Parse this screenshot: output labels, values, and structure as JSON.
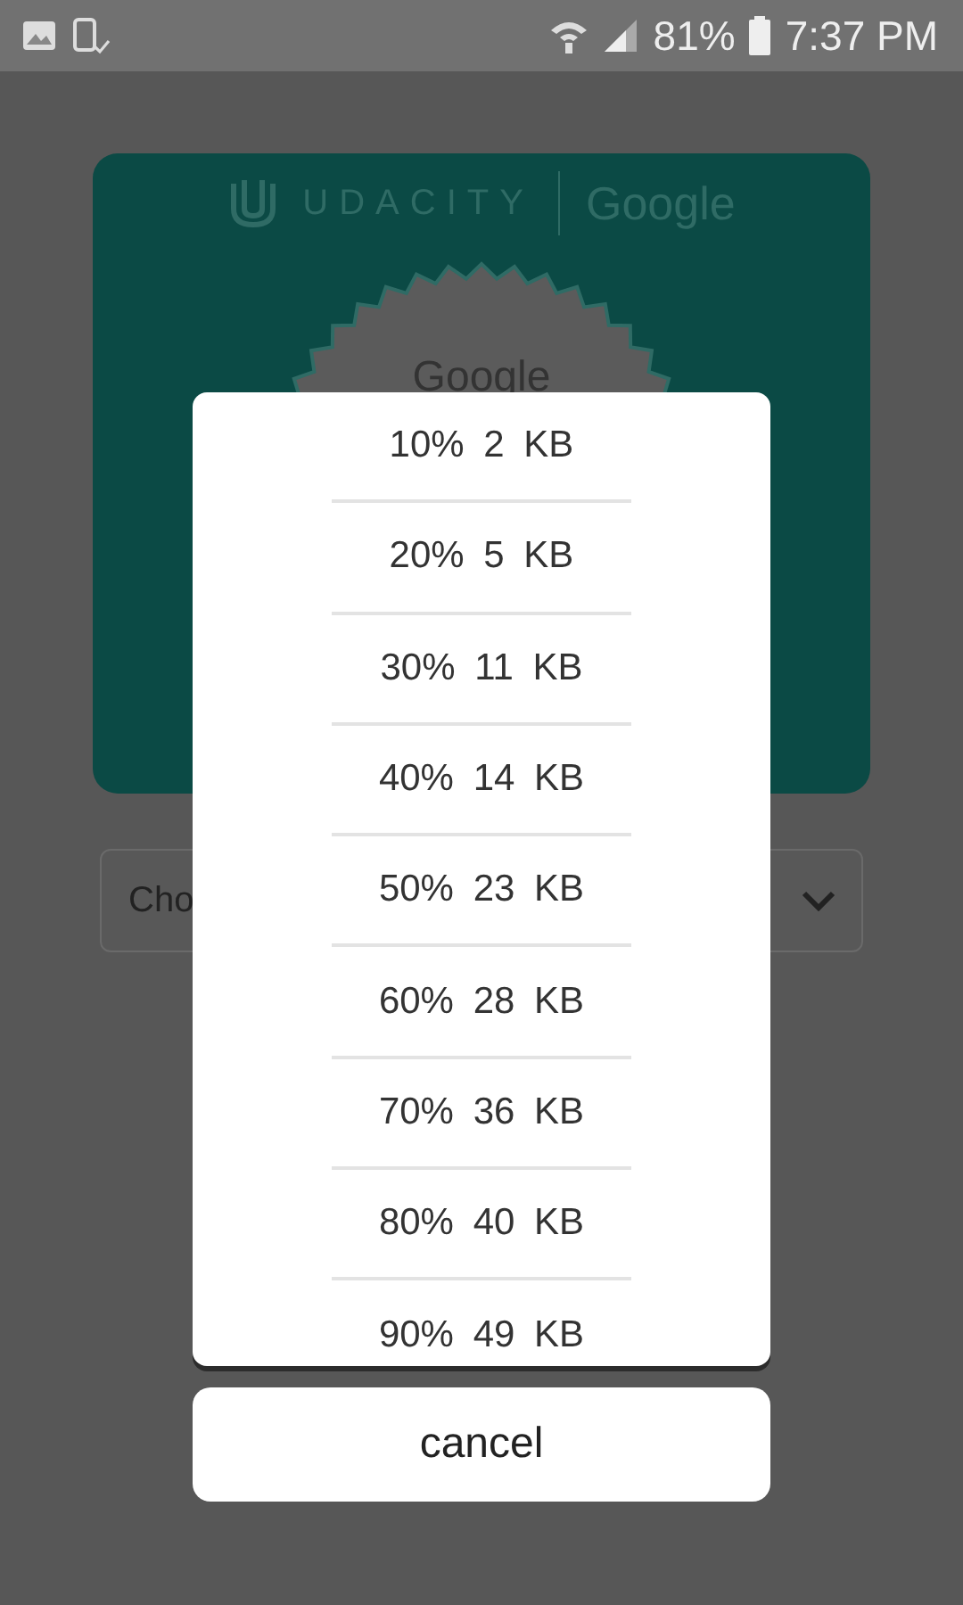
{
  "status_bar": {
    "battery": "81%",
    "time": "7:37 PM"
  },
  "card": {
    "brand": "UDACITY",
    "partner": "Google",
    "badge_text": "Google"
  },
  "dropdown": {
    "value": "Cho"
  },
  "sheet": {
    "options": [
      "10% 2 KB",
      "20% 5 KB",
      "30% 11 KB",
      "40% 14 KB",
      "50% 23 KB",
      "60% 28 KB",
      "70% 36 KB",
      "80% 40 KB",
      "90% 49 KB"
    ],
    "cancel": "cancel"
  }
}
